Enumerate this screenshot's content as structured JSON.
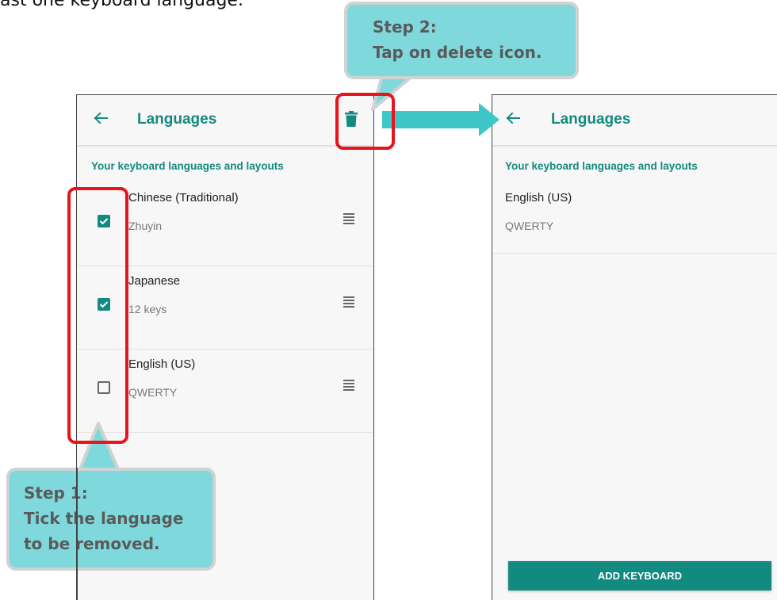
{
  "top_text": "ast one keyboard language.",
  "left_screen": {
    "title": "Languages",
    "section_header": "Your keyboard languages and layouts",
    "languages": [
      {
        "name": "Chinese (Traditional)",
        "layout": "Zhuyin",
        "checked": true
      },
      {
        "name": "Japanese",
        "layout": "12 keys",
        "checked": true
      },
      {
        "name": "English (US)",
        "layout": "QWERTY",
        "checked": false
      }
    ]
  },
  "right_screen": {
    "title": "Languages",
    "section_header": "Your keyboard languages and layouts",
    "languages": [
      {
        "name": "English (US)",
        "layout": "QWERTY"
      }
    ],
    "add_keyboard_label": "ADD KEYBOARD"
  },
  "callouts": {
    "step1": {
      "line1": "Step 1:",
      "line2": "Tick the language",
      "line3": "to be removed."
    },
    "step2": {
      "line1": "Step 2:",
      "line2": "Tap on delete icon."
    }
  },
  "colors": {
    "accent": "#138a80",
    "highlight_red": "#e8141c",
    "callout_fill": "#7fd9dc",
    "arrow": "#3fc6c6"
  },
  "icons": {
    "back": "back-arrow-icon",
    "delete": "trash-icon",
    "drag": "drag-handle-icon",
    "checkbox": "checkbox-icon"
  }
}
